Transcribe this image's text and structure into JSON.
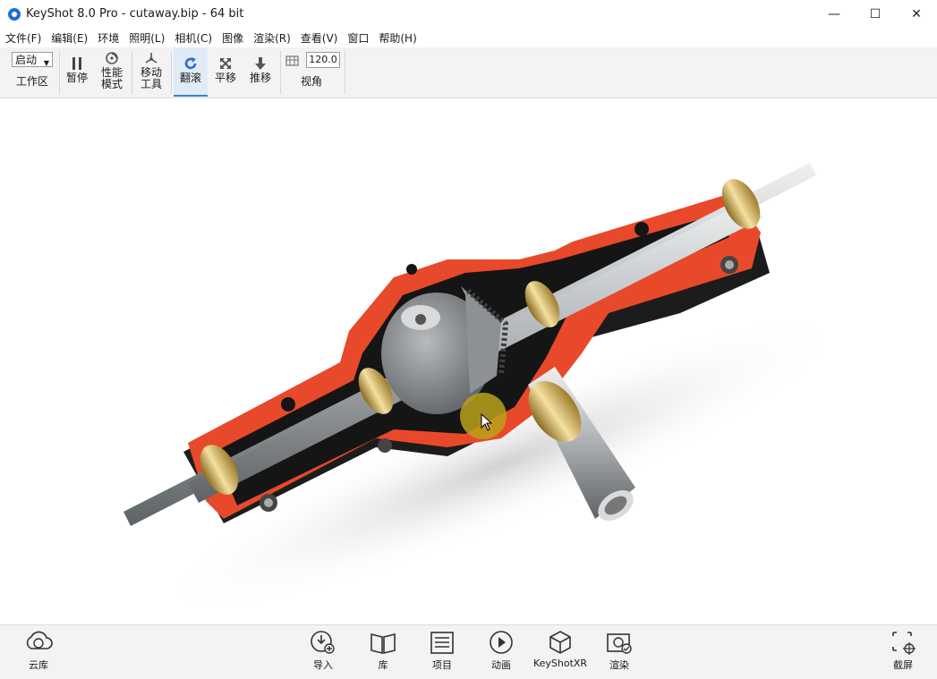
{
  "window": {
    "title": "KeyShot 8.0 Pro  - cutaway.bip  - 64 bit",
    "minimize": "—",
    "maximize": "☐",
    "close": "✕"
  },
  "menu": [
    "文件(F)",
    "编辑(E)",
    "环境",
    "照明(L)",
    "相机(C)",
    "图像",
    "渲染(R)",
    "查看(V)",
    "窗口",
    "帮助(H)"
  ],
  "toolbar": {
    "workspace_value": "启动",
    "workspace_label": "工作区",
    "pause_label": "暂停",
    "performance_label_1": "性能",
    "performance_label_2": "模式",
    "move_tool_label_1": "移动",
    "move_tool_label_2": "工具",
    "tumble_label": "翻滚",
    "pan_label": "平移",
    "dolly_label": "推移",
    "fov_value": "120.0",
    "fov_label": "视角"
  },
  "bottombar": {
    "cloud_library": "云库",
    "import": "导入",
    "library": "库",
    "project": "项目",
    "animation": "动画",
    "keyshotxr": "KeyShotXR",
    "render": "渲染",
    "screenshot": "截屏"
  },
  "colors": {
    "accent": "#3a7ed8",
    "housing_red": "#e8492a",
    "brass": "#c8a84a",
    "steel": "#bfc3c6",
    "cursor_highlight": "#b8a21a"
  },
  "active_tool": "tumble"
}
